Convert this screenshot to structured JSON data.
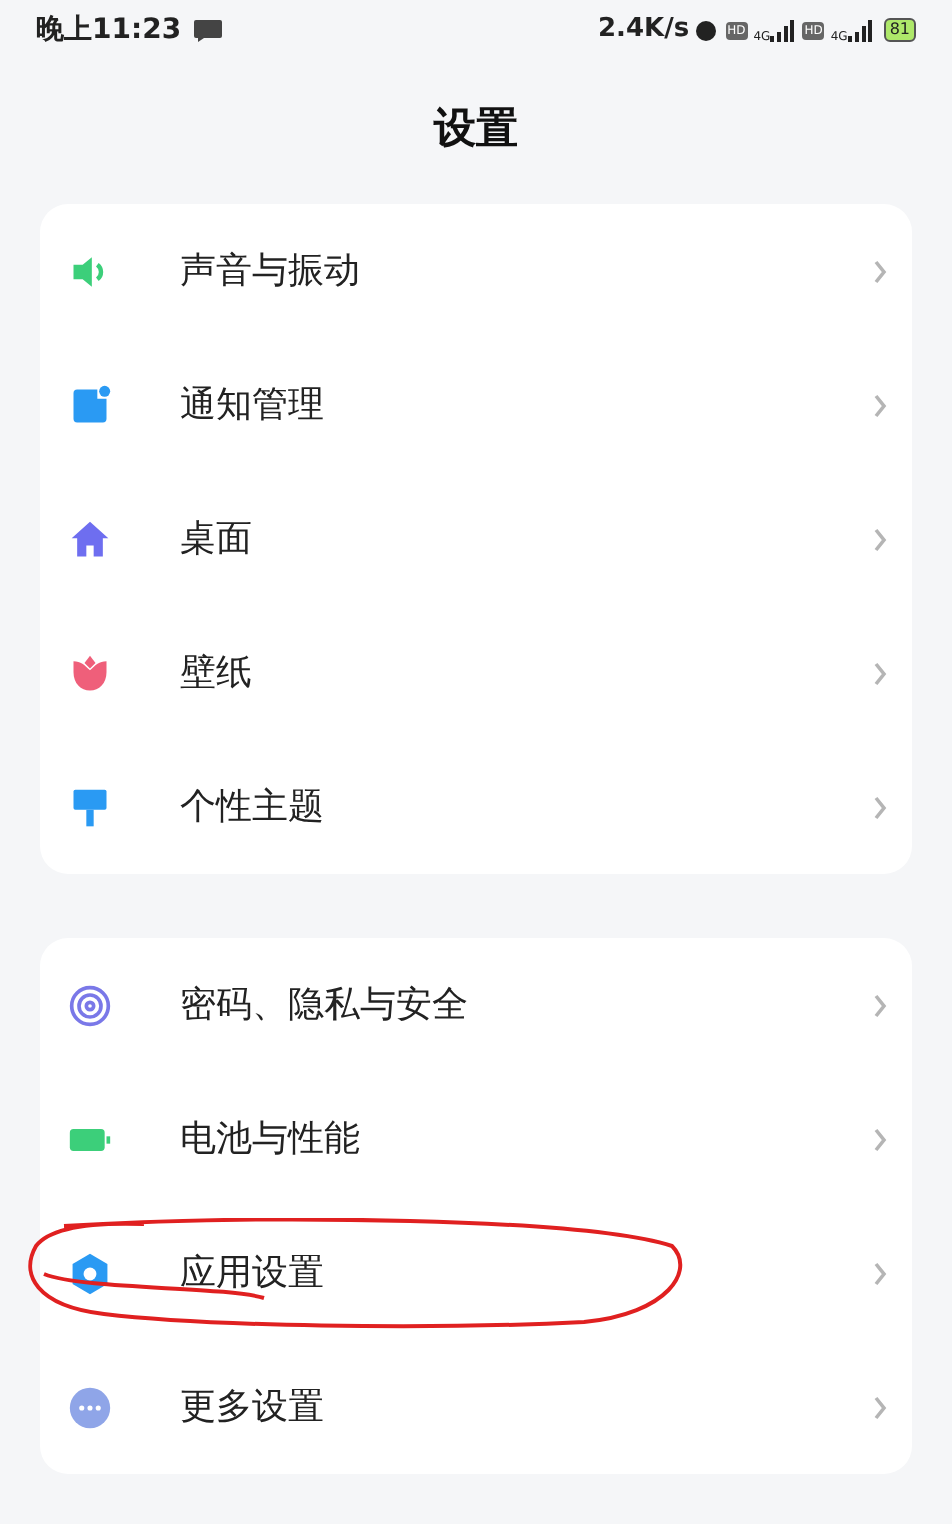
{
  "status_bar": {
    "time": "晚上11:23",
    "speed": "2.4K/s",
    "sims": [
      {
        "hd": "HD",
        "network": "4G"
      },
      {
        "hd": "HD",
        "network": "4G"
      }
    ],
    "battery": "81"
  },
  "title": "设置",
  "groups": [
    {
      "items": [
        {
          "kind": "sound",
          "label": "声音与振动",
          "circled": false
        },
        {
          "kind": "notification",
          "label": "通知管理",
          "circled": false
        },
        {
          "kind": "home",
          "label": "桌面",
          "circled": false
        },
        {
          "kind": "wallpaper",
          "label": "壁纸",
          "circled": false
        },
        {
          "kind": "theme",
          "label": "个性主题",
          "circled": false
        }
      ]
    },
    {
      "items": [
        {
          "kind": "privacy",
          "label": "密码、隐私与安全",
          "circled": false
        },
        {
          "kind": "battery",
          "label": "电池与性能",
          "circled": false
        },
        {
          "kind": "apps",
          "label": "应用设置",
          "circled": true
        },
        {
          "kind": "more",
          "label": "更多设置",
          "circled": false
        }
      ]
    }
  ]
}
